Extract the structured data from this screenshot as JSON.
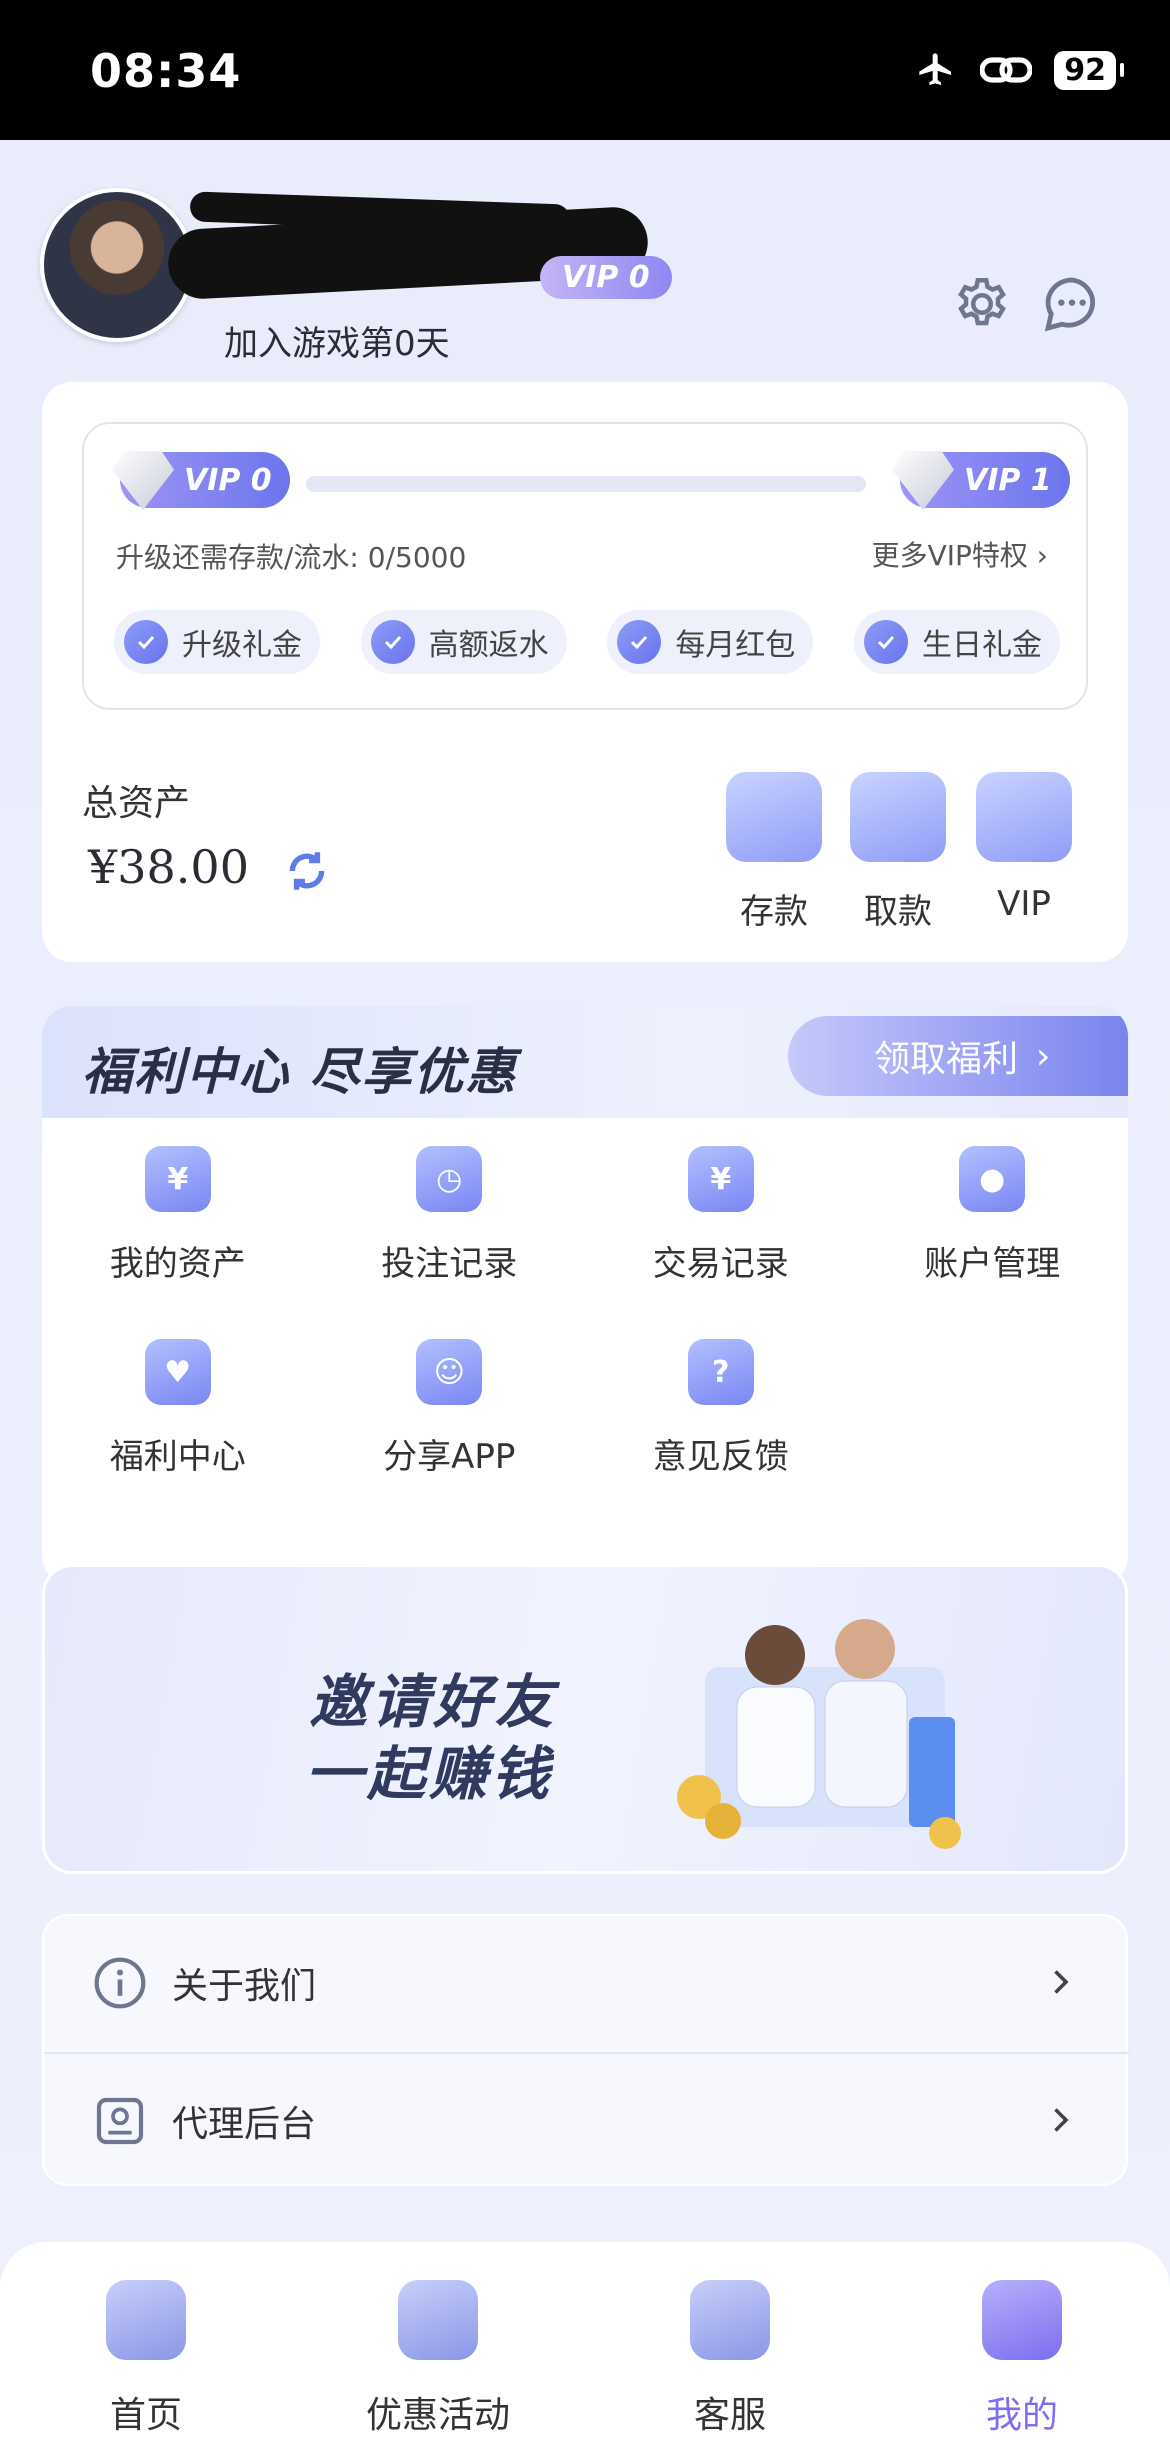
{
  "status_bar": {
    "time": "08:34",
    "battery": "92"
  },
  "profile": {
    "vip_tag": "VIP 0",
    "join_text": "加入游戏第0天"
  },
  "vip_card": {
    "current_level": "VIP 0",
    "next_level": "VIP 1",
    "progress": 0,
    "requirement": "升级还需存款/流水: 0/5000",
    "more_link": "更多VIP特权",
    "benefits": [
      "升级礼金",
      "高额返水",
      "每月红包",
      "生日礼金"
    ]
  },
  "assets": {
    "label": "总资产",
    "value": "¥38.00"
  },
  "actions": [
    {
      "label": "存款",
      "icon": "wallet-icon"
    },
    {
      "label": "取款",
      "icon": "card-icon"
    },
    {
      "label": "VIP",
      "icon": "vip-crown-icon"
    }
  ],
  "welfare": {
    "title": "福利中心 尽享优惠",
    "claim_button": "领取福利",
    "items": [
      {
        "label": "我的资产",
        "icon": "money-bag-icon"
      },
      {
        "label": "投注记录",
        "icon": "calendar-clock-icon"
      },
      {
        "label": "交易记录",
        "icon": "calendar-yen-icon"
      },
      {
        "label": "账户管理",
        "icon": "user-shield-icon"
      },
      {
        "label": "福利中心",
        "icon": "heart-gift-icon"
      },
      {
        "label": "分享APP",
        "icon": "share-user-icon"
      },
      {
        "label": "意见反馈",
        "icon": "question-icon"
      }
    ]
  },
  "promo": {
    "line1": "邀请好友",
    "line2": "一起赚钱"
  },
  "menu": [
    {
      "label": "关于我们",
      "icon": "info-icon"
    },
    {
      "label": "代理后台",
      "icon": "agent-dashboard-icon"
    }
  ],
  "tabs": [
    {
      "label": "首页",
      "icon": "home-icon"
    },
    {
      "label": "优惠活动",
      "icon": "promo-ticket-icon"
    },
    {
      "label": "客服",
      "icon": "headset-icon"
    },
    {
      "label": "我的",
      "icon": "user-icon",
      "active": true
    }
  ],
  "colors": {
    "accent": "#7d6df0",
    "vip_gradient_start": "#9e94f6",
    "vip_gradient_end": "#6c75ec",
    "background": "#e9ecfb"
  }
}
